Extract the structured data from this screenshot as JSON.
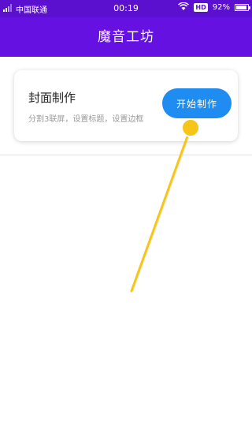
{
  "status_bar": {
    "carrier": "中国联通",
    "time": "00:19",
    "hd_badge": "HD",
    "battery": "92%",
    "icons": [
      "signal-icon",
      "wifi-icon",
      "battery-icon"
    ]
  },
  "app_bar": {
    "title": "魔音工坊"
  },
  "card": {
    "title": "封面制作",
    "subtitle": "分割3联屏，设置标题，设置边框",
    "button_label": "开始制作"
  },
  "colors": {
    "status_bar": "#5b10cf",
    "app_bar": "#6411e1",
    "button": "#1e8cf0",
    "pointer": "#f5c518"
  },
  "overlay": {
    "icon": "tap-pointer-icon"
  }
}
